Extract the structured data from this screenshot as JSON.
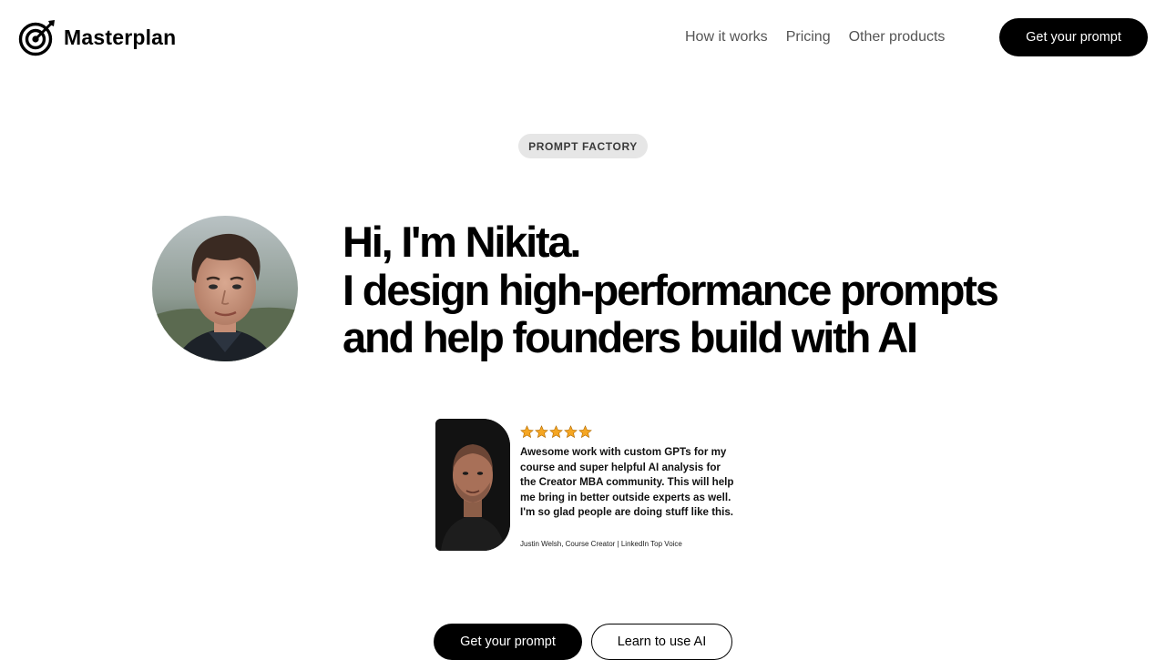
{
  "brand": {
    "name": "Masterplan",
    "logo_icon": "target-dart-icon"
  },
  "nav": {
    "items": [
      {
        "label": "How it works"
      },
      {
        "label": "Pricing"
      },
      {
        "label": "Other products"
      }
    ],
    "cta_label": "Get your prompt"
  },
  "badge": "PROMPT FACTORY",
  "hero": {
    "title_lines": [
      "Hi, I'm Nikita.",
      "I design high-performance prompts",
      "and help founders build with AI"
    ],
    "avatar_icon": "author-avatar-photo"
  },
  "testimonial": {
    "rating": 5,
    "rating_max": 5,
    "quote": "Awesome work with custom GPTs for my course and super helpful AI analysis for the Creator MBA community. This will help me bring in better outside experts as well. I'm so glad people are doing stuff like this.",
    "author": "Justin Welsh, Course Creator | LinkedIn Top Voice",
    "photo_icon": "testimonial-author-photo"
  },
  "ctas": {
    "primary_label": "Get your prompt",
    "secondary_label": "Learn to use AI"
  },
  "colors": {
    "primary": "#000000",
    "background": "#ffffff",
    "nav_text": "#555555",
    "badge_bg": "#e6e6e6",
    "star": "#f5a623"
  }
}
